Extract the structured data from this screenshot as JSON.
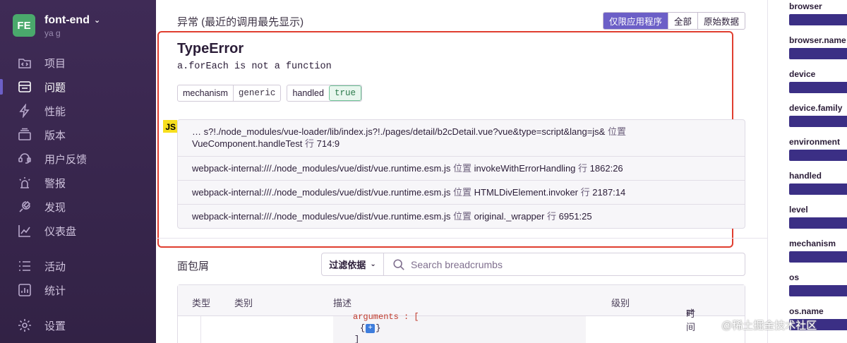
{
  "sidebar": {
    "org_initials": "FE",
    "org_name": "font-end",
    "org_user": "ya g",
    "items": [
      {
        "label": "项目",
        "icon": "projects-icon"
      },
      {
        "label": "问题",
        "icon": "issues-icon"
      },
      {
        "label": "性能",
        "icon": "performance-icon"
      },
      {
        "label": "版本",
        "icon": "releases-icon"
      },
      {
        "label": "用户反馈",
        "icon": "user-feedback-icon"
      },
      {
        "label": "警报",
        "icon": "alerts-icon"
      },
      {
        "label": "发现",
        "icon": "discover-icon"
      },
      {
        "label": "仪表盘",
        "icon": "dashboards-icon"
      }
    ],
    "secondary": [
      {
        "label": "活动",
        "icon": "activity-icon"
      },
      {
        "label": "统计",
        "icon": "stats-icon"
      }
    ],
    "settings_label": "设置"
  },
  "exception": {
    "heading": "异常 (最近的调用最先显示)",
    "toggle": [
      "仅限应用程序",
      "全部",
      "原始数据"
    ],
    "type": "TypeError",
    "message": "a.forEach is not a function",
    "mechanism_key": "mechanism",
    "mechanism_value": "generic",
    "handled_key": "handled",
    "handled_value": "true",
    "platform_badge": "JS",
    "frames": [
      {
        "file": "… s?!./node_modules/vue-loader/lib/index.js?!./pages/detail/b2cDetail.vue?vue&type=script&lang=js&",
        "at": "位置",
        "func": "VueComponent.handleTest",
        "line_word": "行",
        "pos": "714:9"
      },
      {
        "file": "webpack-internal:///./node_modules/vue/dist/vue.runtime.esm.js",
        "at": "位置",
        "func": "invokeWithErrorHandling",
        "line_word": "行",
        "pos": "1862:26"
      },
      {
        "file": "webpack-internal:///./node_modules/vue/dist/vue.runtime.esm.js",
        "at": "位置",
        "func": "HTMLDivElement.invoker",
        "line_word": "行",
        "pos": "2187:14"
      },
      {
        "file": "webpack-internal:///./node_modules/vue/dist/vue.runtime.esm.js",
        "at": "位置",
        "func": "original._wrapper",
        "line_word": "行",
        "pos": "6951:25"
      }
    ]
  },
  "breadcrumbs": {
    "title": "面包屑",
    "filter_label": "过滤依据",
    "search_placeholder": "Search breadcrumbs",
    "columns": {
      "type": "类型",
      "category": "类别",
      "description": "描述",
      "level": "级别",
      "time": "时间"
    },
    "code_line1": "arguments : [",
    "code_line2_open": "{",
    "code_line2_close": "}",
    "code_line3": "]"
  },
  "tags_panel": {
    "keys": [
      "browser",
      "browser.name",
      "device",
      "device.family",
      "environment",
      "handled",
      "level",
      "mechanism",
      "os",
      "os.name"
    ],
    "bar_color": "#3b2f85"
  },
  "watermark": "@稀土掘金技术社区",
  "colors": {
    "accent": "#6c5fc7",
    "sidebar": "#3f2b56",
    "highlight_border": "#e03e2f"
  }
}
